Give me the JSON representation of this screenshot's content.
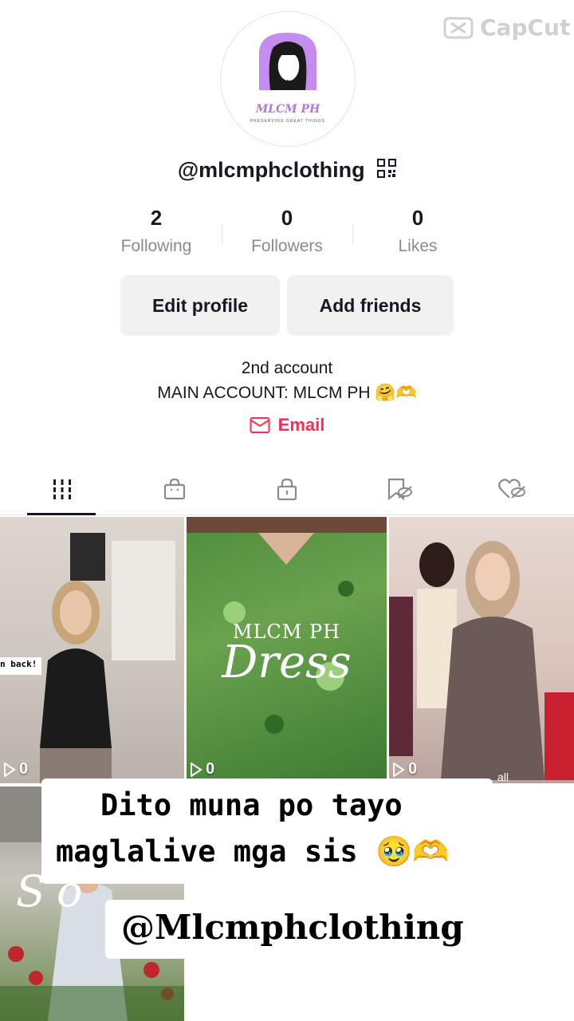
{
  "watermark": {
    "text": "CapCut"
  },
  "profile": {
    "handle": "@mlcmphclothing",
    "logo_text": "MLCM PH",
    "logo_tagline": "PRESERVING GREAT THINGS"
  },
  "stats": [
    {
      "value": "2",
      "label": "Following"
    },
    {
      "value": "0",
      "label": "Followers"
    },
    {
      "value": "0",
      "label": "Likes"
    }
  ],
  "buttons": {
    "edit_profile": "Edit profile",
    "add_friends": "Add friends"
  },
  "bio": {
    "line1": "2nd account",
    "line2": "MAIN ACCOUNT: MLCM PH 🤗🫶"
  },
  "email": {
    "label": "Email"
  },
  "tabs": [
    "videos-tab",
    "shop-tab",
    "private-tab",
    "reposts-tab",
    "liked-tab"
  ],
  "videos": [
    {
      "views": "0",
      "overlay": "n back!"
    },
    {
      "views": "0",
      "overlay_top": "MLCM PH",
      "overlay_big": "Dress"
    },
    {
      "views": "0",
      "overlay": "all"
    },
    {
      "views": "",
      "overlay": "So"
    }
  ],
  "captions": {
    "line1": "Dito muna po tayo",
    "line2": "maglalive mga sis 🥹🫶",
    "handle": "@Mlcmphclothing"
  },
  "colors": {
    "accent": "#fe2c55",
    "button_bg": "#f1f1f2",
    "logo_purple": "#c58cf0"
  }
}
